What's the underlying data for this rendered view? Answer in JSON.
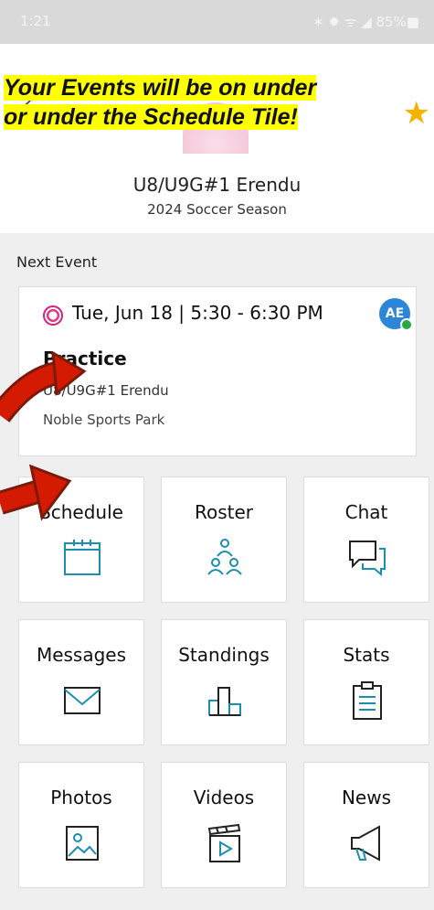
{
  "status_bar": {
    "time": "1:21",
    "icons": "✶ ✹ ᯤ ◢ 85%■"
  },
  "banner": {
    "line1": "Your Events will be on under",
    "line2": "or under the Schedule Tile!"
  },
  "header": {
    "team_name": "U8/U9G#1 Erendu",
    "season": "2024 Soccer Season"
  },
  "next_event": {
    "label": "Next Event",
    "date": "Tue, Jun 18 | 5:30 - 6:30 PM",
    "avatar_initials": "AE",
    "title": "Practice",
    "team": "U8/U9G#1 Erendu",
    "location": "Noble Sports Park"
  },
  "tiles": [
    {
      "label": "Schedule",
      "icon": "calendar-icon"
    },
    {
      "label": "Roster",
      "icon": "people-icon"
    },
    {
      "label": "Chat",
      "icon": "chat-bubbles-icon"
    },
    {
      "label": "Messages",
      "icon": "envelope-icon"
    },
    {
      "label": "Standings",
      "icon": "podium-icon"
    },
    {
      "label": "Stats",
      "icon": "clipboard-icon"
    },
    {
      "label": "Photos",
      "icon": "photo-icon"
    },
    {
      "label": "Videos",
      "icon": "clapperboard-icon"
    },
    {
      "label": "News",
      "icon": "megaphone-icon"
    }
  ],
  "colors": {
    "accent": "#2b86d8",
    "icon": "#1c8fb0",
    "banner_highlight": "#ffff00",
    "arrow": "#cc1100"
  }
}
